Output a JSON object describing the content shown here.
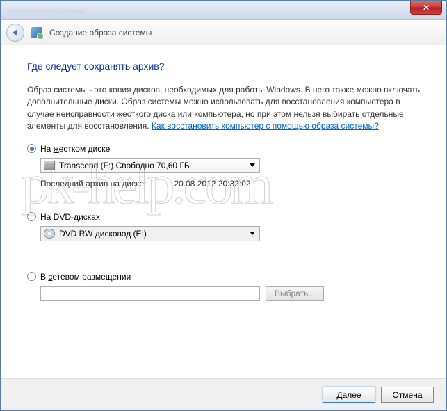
{
  "window": {
    "title_blurred": "——————  ———",
    "header_title": "Создание образа системы"
  },
  "page": {
    "heading": "Где следует сохранять архив?",
    "paragraph": "Образ системы - это копия дисков, необходимых для работы Windows. В него также можно включать дополнительные диски. Образ системы можно использовать для восстановления компьютера в случае неисправности жесткого диска или компьютера, но при этом нельзя выбирать отдельные элементы для восстановления. ",
    "help_link": "Как восстановить компьютер с помощью образа системы?"
  },
  "opt_hdd": {
    "label_pre": "На ",
    "label_u": "ж",
    "label_post": "естком диске",
    "combo_text": "Transcend (F:)  Свободно 70,60 ГБ",
    "last_label": "Последний архив на диске:",
    "last_value": "20.08.2012 20:32:02"
  },
  "opt_dvd": {
    "label": "На DVD-дисках",
    "combo_text": "DVD RW дисковод (E:)"
  },
  "opt_net": {
    "label_pre": "В ",
    "label_u": "с",
    "label_post": "етевом размещении",
    "textbox_value": "",
    "browse_label": "Выбрать..."
  },
  "footer": {
    "next": "Далее",
    "cancel": "Отмена"
  },
  "watermark": "pk-help.com"
}
